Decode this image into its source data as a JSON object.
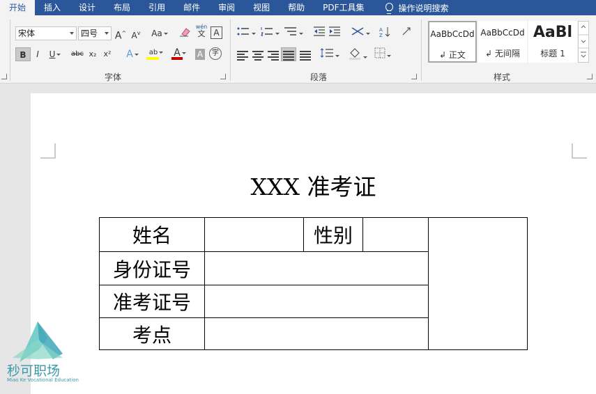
{
  "tabs": [
    "开始",
    "插入",
    "设计",
    "布局",
    "引用",
    "邮件",
    "审阅",
    "视图",
    "帮助",
    "PDF工具集"
  ],
  "help_search": "操作说明搜索",
  "font": {
    "name": "宋体",
    "size": "四号",
    "grow": "A",
    "shrink": "A",
    "case": "Aa",
    "phonetic_top": "wén",
    "phonetic_bottom": "文",
    "charborder": "A",
    "bold": "B",
    "italic": "I",
    "underline": "U",
    "strike": "abc",
    "subscript": "x₂",
    "superscript": "x²",
    "effects": "A",
    "highlight": "ab",
    "color": "A",
    "shading": "A",
    "enclose": "字",
    "label": "字体"
  },
  "paragraph": {
    "label": "段落"
  },
  "styles": {
    "label": "样式",
    "items": [
      {
        "sample": "AaBbCcDd",
        "name": "正文"
      },
      {
        "sample": "AaBbCcDd",
        "name": "无间隔"
      },
      {
        "sample": "AaBl",
        "name": "标题 1"
      }
    ]
  },
  "document": {
    "title": "XXX 准考证",
    "table": {
      "name_label": "姓名",
      "gender_label": "性别",
      "id_label": "身份证号",
      "ticket_label": "准考证号",
      "site_label": "考点"
    }
  },
  "watermark": {
    "name": "秒可职场",
    "sub": "Miao Ke Vocational Education"
  },
  "colors": {
    "ribbon_blue": "#2b579a",
    "font_color_red": "#c00000",
    "highlight_yellow": "#ffff00",
    "logo_teal": "#3a9aa8"
  }
}
